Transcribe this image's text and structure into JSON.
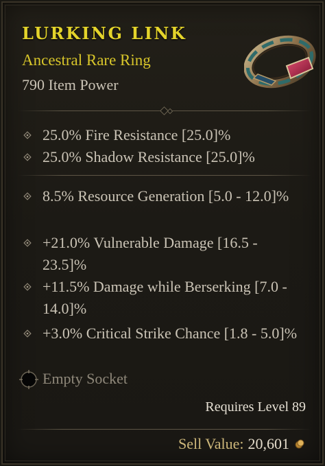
{
  "item": {
    "name": "LURKING LINK",
    "type": "Ancestral Rare Ring",
    "power": "790 Item Power",
    "icon": "ring-icon"
  },
  "implicits": [
    "25.0% Fire Resistance [25.0]%",
    "25.0% Shadow Resistance [25.0]%"
  ],
  "affixes": [
    "8.5% Resource Generation [5.0 - 12.0]%",
    "+21.0% Vulnerable Damage [16.5 - 23.5]%",
    "+11.5% Damage while Berserking [7.0 - 14.0]%",
    "+3.0% Critical Strike Chance [1.8 - 5.0]%"
  ],
  "socket": {
    "label": "Empty Socket"
  },
  "requirements": "Requires Level 89",
  "sell": {
    "label": "Sell Value:",
    "value": "20,601",
    "icon": "gold-coin-icon"
  },
  "colors": {
    "name": "#e4d42b",
    "rarity": "#d8c62a",
    "text": "#cbc4b6",
    "socket": "#8f887a",
    "sell_label": "#cdb77a"
  }
}
